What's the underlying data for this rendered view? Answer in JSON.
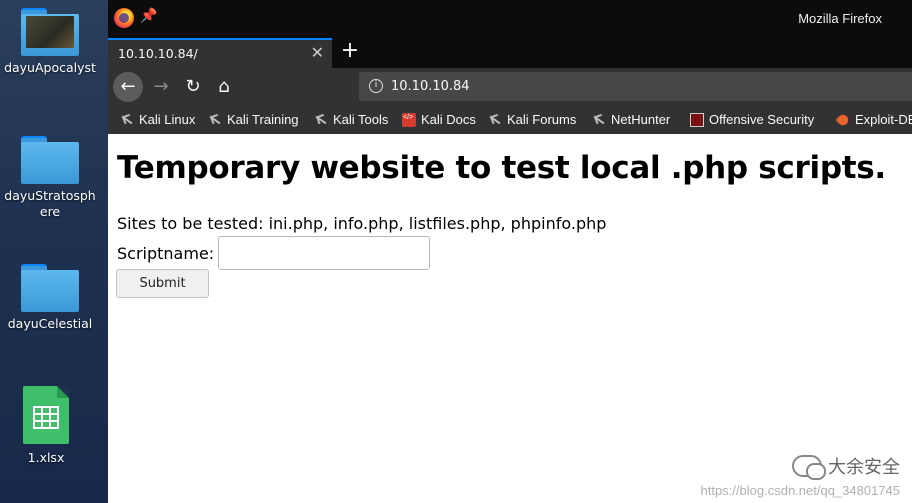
{
  "desktop": {
    "icons": [
      {
        "label": "dayuApocalyst",
        "icon": "folder-image-icon"
      },
      {
        "label": "dayuStratosphere",
        "icon": "folder-icon"
      },
      {
        "label": "dayuCelestial",
        "icon": "folder-icon"
      },
      {
        "label": "1.xlsx",
        "icon": "spreadsheet-icon"
      }
    ]
  },
  "window": {
    "title": "Mozilla Firefox",
    "tab": {
      "title": "10.10.10.84/",
      "close_icon": "close-icon"
    },
    "new_tab_label": "+",
    "url": "10.10.10.84",
    "bookmarks": [
      {
        "label": "Kali Linux",
        "icon": "kali-dragon-icon"
      },
      {
        "label": "Kali Training",
        "icon": "kali-dragon-icon"
      },
      {
        "label": "Kali Tools",
        "icon": "kali-dragon-icon"
      },
      {
        "label": "Kali Docs",
        "icon": "docs-icon"
      },
      {
        "label": "Kali Forums",
        "icon": "kali-dragon-icon"
      },
      {
        "label": "NetHunter",
        "icon": "kali-dragon-icon"
      },
      {
        "label": "Offensive Security",
        "icon": "offsec-icon"
      },
      {
        "label": "Exploit-DB",
        "icon": "exploit-db-icon"
      }
    ]
  },
  "page": {
    "heading": "Temporary website to test local .php scripts.",
    "sites_text": "Sites to be tested: ini.php, info.php, listfiles.php, phpinfo.php",
    "script_label": "Scriptname:",
    "script_value": "",
    "submit_label": "Submit"
  },
  "watermark": {
    "brand": "大余安全",
    "url": "https://blog.csdn.net/qq_34801745"
  },
  "colors": {
    "accent": "#0a84ff",
    "toolbar": "#323234",
    "titlebar": "#0c0c0d"
  }
}
